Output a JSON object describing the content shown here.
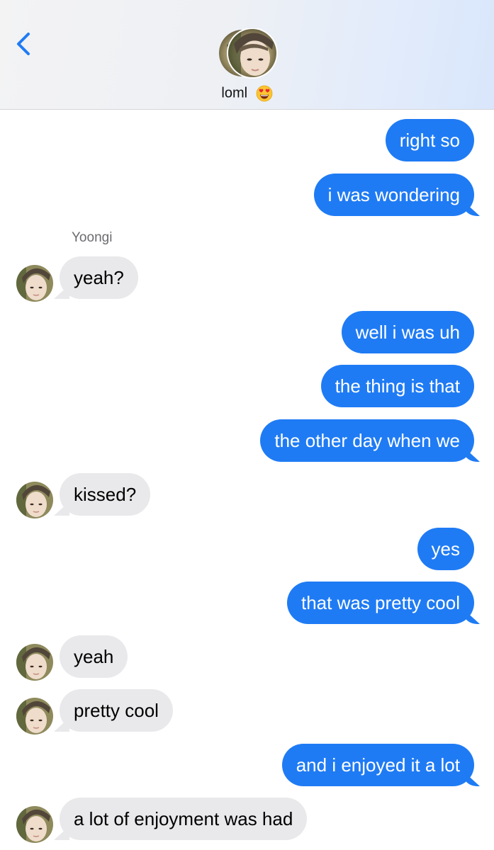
{
  "header": {
    "contact_name": "loml",
    "emoji_icon": "heart-eyes-emoji",
    "back_icon": "chevron-left-icon"
  },
  "colors": {
    "outgoing_bubble": "#1f7bf4",
    "incoming_bubble": "#e9e9eb",
    "accent": "#1f7bf4"
  },
  "sender_label": "Yoongi",
  "messages": [
    {
      "direction": "outgoing",
      "text": "right so"
    },
    {
      "direction": "outgoing",
      "text": "i was wondering"
    },
    {
      "direction": "incoming",
      "text": "yeah?"
    },
    {
      "direction": "outgoing",
      "text": "well i was uh"
    },
    {
      "direction": "outgoing",
      "text": "the thing is that"
    },
    {
      "direction": "outgoing",
      "text": "the other day when we"
    },
    {
      "direction": "incoming",
      "text": "kissed?"
    },
    {
      "direction": "outgoing",
      "text": "yes"
    },
    {
      "direction": "outgoing",
      "text": "that was pretty cool"
    },
    {
      "direction": "incoming",
      "text": "yeah"
    },
    {
      "direction": "incoming",
      "text": "pretty cool"
    },
    {
      "direction": "outgoing",
      "text": "and i enjoyed it a lot"
    },
    {
      "direction": "incoming",
      "text": "a lot of enjoyment was had"
    }
  ]
}
